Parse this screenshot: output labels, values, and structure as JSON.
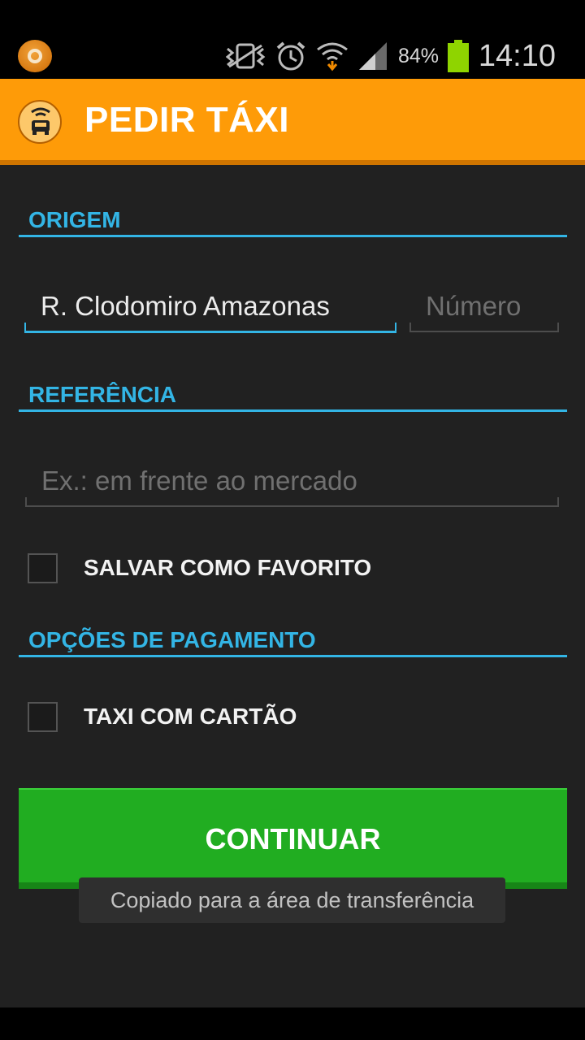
{
  "status_bar": {
    "icons": [
      "app-notification-icon",
      "vibrate-icon",
      "alarm-icon",
      "wifi-icon",
      "signal-icon",
      "battery-icon"
    ],
    "battery_percent": "84%",
    "time": "14:10"
  },
  "action_bar": {
    "icon": "taxi-icon",
    "title": "PEDIR TÁXI"
  },
  "form": {
    "origin_header": "ORIGEM",
    "street_value": "R. Clodomiro Amazonas",
    "number_placeholder": "Número",
    "reference_header": "REFERÊNCIA",
    "reference_placeholder": "Ex.: em frente ao mercado",
    "save_favorite_label": "SALVAR COMO FAVORITO",
    "save_favorite_checked": false,
    "payment_header": "OPÇÕES DE PAGAMENTO",
    "card_taxi_label": "TAXI COM CARTÃO",
    "card_taxi_checked": false
  },
  "continue_button": "CONTINUAR",
  "toast": "Copiado para a área de transferência",
  "colors": {
    "accent": "#33b5e5",
    "action_bar": "#fe9b08",
    "button": "#21ad21",
    "background": "#212121"
  }
}
